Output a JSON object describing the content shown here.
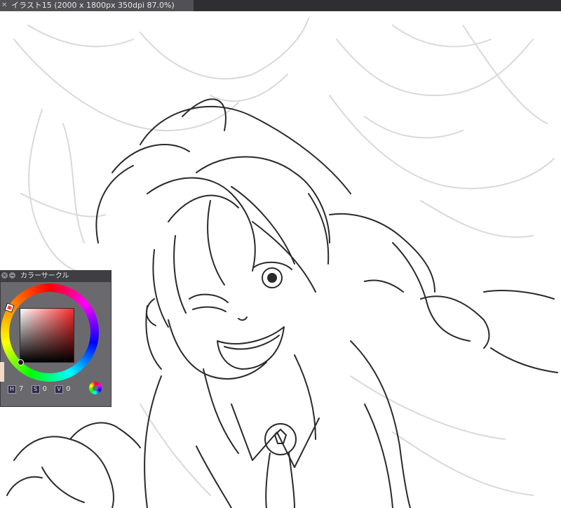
{
  "window": {
    "tab_close_glyph": "✕",
    "document_title": "イラスト15 (2000 x 1800px 350dpi 87.0%)"
  },
  "color_circle": {
    "title": "カラーサークル",
    "close_glyph": "✕",
    "hsv": {
      "h_key": "H",
      "h_value": "7",
      "s_key": "S",
      "s_value": "0",
      "v_key": "V",
      "v_value": "0"
    },
    "icon_names": {
      "close": "close-icon",
      "minimize": "minimize-icon",
      "mode": "color-mode-icon"
    }
  },
  "colors": {
    "canvas_bg": "#ffffff",
    "line_ink": "#2a2a2a",
    "sketch_gray": "#d9d9d9",
    "panel_bg": "#6a6a6e"
  }
}
